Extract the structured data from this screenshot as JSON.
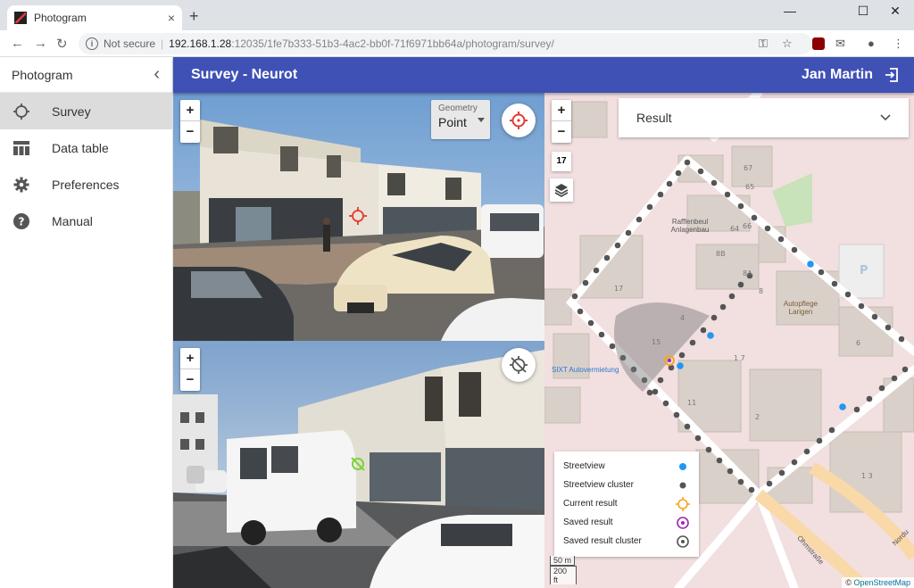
{
  "browser": {
    "tab_title": "Photogram",
    "tab_close": "×",
    "new_tab": "+",
    "url_security": "Not secure",
    "url_host": "192.168.1.28",
    "url_path": ":12035/1fe7b333-51b3-4ac2-bb0f-71f6971bb64a/photogram/survey/"
  },
  "sidebar": {
    "title": "Photogram",
    "collapse": "‹",
    "items": [
      {
        "label": "Survey",
        "icon": "crosshair-icon"
      },
      {
        "label": "Data table",
        "icon": "table-icon"
      },
      {
        "label": "Preferences",
        "icon": "gear-icon"
      },
      {
        "label": "Manual",
        "icon": "help-icon"
      }
    ]
  },
  "appbar": {
    "title": "Survey - Neurot",
    "user": "Jan Martin"
  },
  "photo_top": {
    "zoom_in": "+",
    "zoom_out": "−",
    "geometry_label": "Geometry",
    "geometry_value": "Point"
  },
  "photo_bottom": {
    "zoom_in": "+",
    "zoom_out": "−"
  },
  "map": {
    "zoom_in": "+",
    "zoom_out": "−",
    "zoom_level": "17",
    "result_placeholder": "Result",
    "labels": {
      "poi1": "Rafflenbeul Anlagenbau",
      "poi2": "Autopflege Larigen",
      "poi3": "SIXT Autovermietung",
      "street1": "Ohmstraße",
      "street2": "Nordu",
      "parking": "P"
    },
    "house_numbers": [
      "67",
      "65",
      "66",
      "64",
      "8B",
      "8A",
      "8",
      "17",
      "4",
      "15",
      "17",
      "11",
      "2",
      "6",
      "13"
    ],
    "scale_m": "50 m",
    "scale_ft": "200 ft",
    "attribution_prefix": "© ",
    "attribution_link": "OpenStreetMap",
    "legend": [
      {
        "label": "Streetview",
        "symbol": "blue-dot"
      },
      {
        "label": "Streetview cluster",
        "symbol": "gray-dot"
      },
      {
        "label": "Current result",
        "symbol": "orange-target"
      },
      {
        "label": "Saved result",
        "symbol": "purple-target"
      },
      {
        "label": "Saved result cluster",
        "symbol": "gray-target"
      }
    ]
  },
  "colors": {
    "primary": "#3f51b5",
    "accent": "#e53935",
    "streetview": "#2196f3",
    "cluster": "#555555",
    "current_result": "#f5a623",
    "saved_result": "#9c27b0"
  }
}
